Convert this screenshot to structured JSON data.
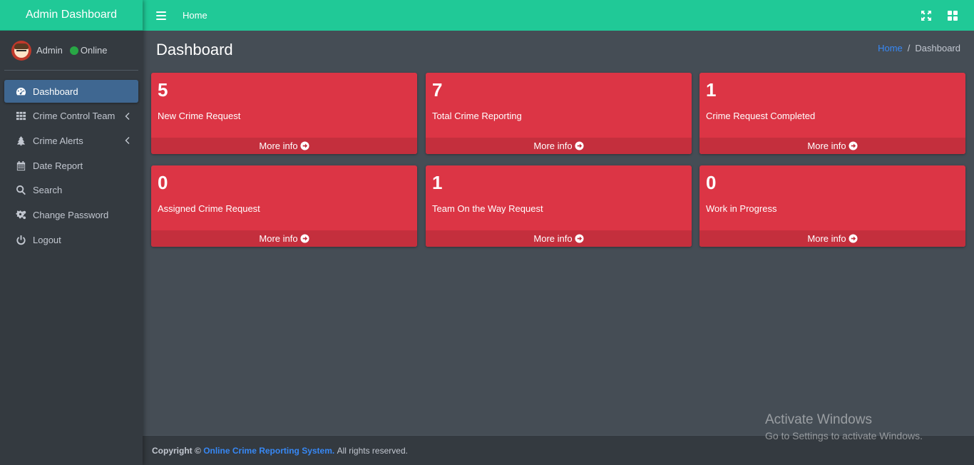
{
  "sidebar": {
    "brand": "Admin Dashboard",
    "user": {
      "name": "Admin",
      "status": "Online",
      "status_color": "#28a745"
    },
    "items": [
      {
        "label": "Dashboard",
        "icon": "tachometer-icon",
        "active": true
      },
      {
        "label": "Crime Control Team",
        "icon": "grid-icon",
        "has_arrow": true
      },
      {
        "label": "Crime Alerts",
        "icon": "tree-icon",
        "has_arrow": true
      },
      {
        "label": "Date Report",
        "icon": "calendar-icon"
      },
      {
        "label": "Search",
        "icon": "search-icon"
      },
      {
        "label": "Change Password",
        "icon": "cogs-icon"
      },
      {
        "label": "Logout",
        "icon": "power-icon"
      }
    ]
  },
  "topbar": {
    "home_label": "Home",
    "accent_color": "#20c997"
  },
  "page": {
    "title": "Dashboard",
    "breadcrumb": {
      "home": "Home",
      "separator": "/",
      "current": "Dashboard"
    }
  },
  "boxes": [
    {
      "count": "5",
      "label": "New Crime Request",
      "more": "More info"
    },
    {
      "count": "7",
      "label": "Total Crime Reporting",
      "more": "More info"
    },
    {
      "count": "1",
      "label": "Crime Request Completed",
      "more": "More info"
    },
    {
      "count": "0",
      "label": "Assigned Crime Request",
      "more": "More info"
    },
    {
      "count": "1",
      "label": "Team On the Way Request",
      "more": "More info"
    },
    {
      "count": "0",
      "label": "Work in Progress",
      "more": "More info"
    }
  ],
  "box_color": "#dc3545",
  "footer": {
    "prefix": "Copyright ©",
    "link": "Online Crime Reporting System.",
    "suffix": "All rights reserved."
  },
  "watermark": {
    "title": "Activate Windows",
    "subtitle": "Go to Settings to activate Windows."
  }
}
